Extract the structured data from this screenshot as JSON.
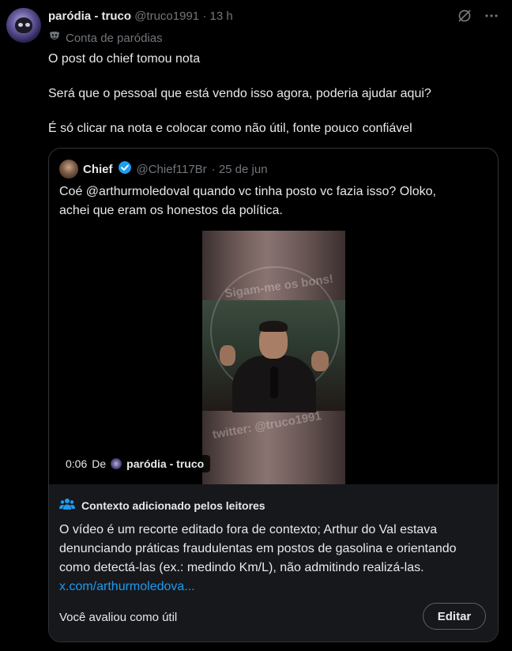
{
  "post": {
    "author_name": "paródia - truco",
    "author_handle": "@truco1991",
    "time": "· 13 h",
    "parody_label": "Conta de paródias",
    "parody_icon": "mask-icon",
    "text_lines": [
      "O post do chief tomou nota",
      "Será que o pessoal que está vendo isso agora, poderia ajudar aqui?",
      " É só clicar na nota e colocar como não útil, fonte pouco confiável"
    ]
  },
  "quoted": {
    "author_name": "Chief",
    "author_handle": "@Chief117Br",
    "date": "· 25 de jun",
    "verified_color": "#1d9bf0",
    "text_lines": [
      "Coé @arthurmoledoval quando vc tinha posto vc fazia isso? Oloko,",
      "achei que eram os honestos da política."
    ],
    "video": {
      "timestamp": "0:06",
      "by_label": "De",
      "source_name": "paródia - truco",
      "watermark_top": "Sigam-me os bons!",
      "watermark_bottom": "twitter: @truco1991"
    }
  },
  "community_note": {
    "title": "Contexto adicionado pelos leitores",
    "lines": [
      "O vídeo é um recorte editado fora de contexto; Arthur do Val estava",
      "denunciando práticas fraudulentas em postos de gasolina e orientando",
      "como detectá-las (ex.: medindo Km/L), não admitindo realizá-las."
    ],
    "link": "x.com/arthurmoledova...",
    "rated_text": "Você avaliou como útil",
    "edit_label": "Editar",
    "link_color": "#1d9bf0"
  },
  "icons": [
    "grok-icon",
    "more-icon",
    "verified-icon",
    "people-icon"
  ]
}
